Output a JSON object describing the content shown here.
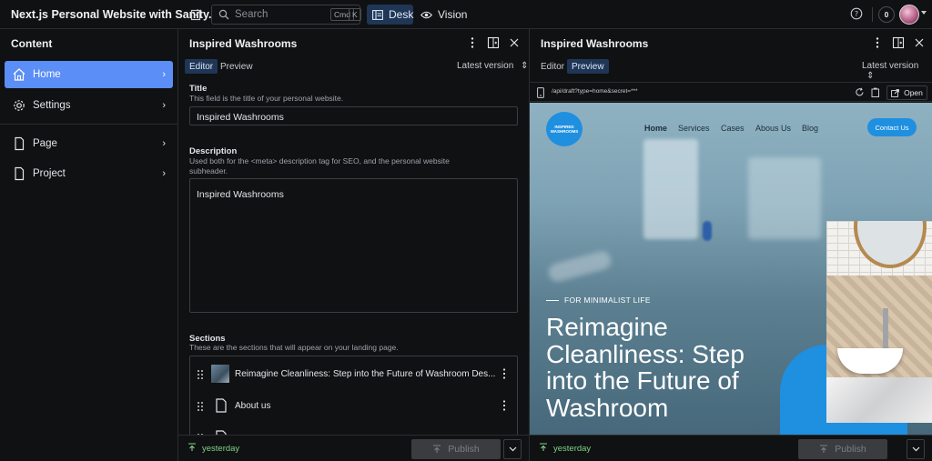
{
  "app": {
    "title": "Next.js Personal Website with Sanity.io",
    "search_placeholder": "Search",
    "shortcut_cmd": "Cmd",
    "shortcut_key": "K",
    "tools": [
      {
        "label": "Desk",
        "icon": "desk-icon",
        "active": true
      },
      {
        "label": "Vision",
        "icon": "eye-icon",
        "active": false
      }
    ],
    "notification_count": "0"
  },
  "sidebar": {
    "title": "Content",
    "items": [
      {
        "label": "Home",
        "icon": "home-icon",
        "active": true
      },
      {
        "label": "Settings",
        "icon": "gear-icon",
        "active": false
      },
      {
        "label": "Page",
        "icon": "document-icon",
        "active": false
      },
      {
        "label": "Project",
        "icon": "document-icon",
        "active": false
      }
    ]
  },
  "editor": {
    "title": "Inspired Washrooms",
    "tabs": [
      "Editor",
      "Preview"
    ],
    "active_tab": "Editor",
    "version_label": "Latest version",
    "fields": {
      "title_label": "Title",
      "title_help": "This field is the title of your personal website.",
      "title_value": "Inspired Washrooms",
      "description_label": "Description",
      "description_help": "Used both for the <meta> description tag for SEO, and the personal website subheader.",
      "description_value": "Inspired Washrooms",
      "sections_label": "Sections",
      "sections_help": "These are the sections that will appear on your landing page."
    },
    "sections": [
      {
        "label": "Reimagine Cleanliness: Step into the Future of Washroom Des..."
      },
      {
        "label": "About us"
      }
    ],
    "status": "yesterday",
    "publish_label": "Publish"
  },
  "preview": {
    "title": "Inspired Washrooms",
    "tabs": [
      "Editor",
      "Preview"
    ],
    "active_tab": "Preview",
    "version_label": "Latest version",
    "url": "/api/draft?type=home&secret=***",
    "open_label": "Open",
    "status": "yesterday",
    "publish_label": "Publish",
    "site": {
      "logo_text": "INSPIRED WASHROOMS",
      "nav": [
        "Home",
        "Services",
        "Cases",
        "Abous Us",
        "Blog"
      ],
      "contact_label": "Contact Us",
      "eyebrow": "FOR MINIMALIST LIFE",
      "hero": "Reimagine Cleanliness: Step into the Future of Washroom"
    }
  },
  "colors": {
    "accent": "#5b8ef6",
    "brand_blue": "#1f8fe0",
    "status_green": "#7fd38a"
  }
}
